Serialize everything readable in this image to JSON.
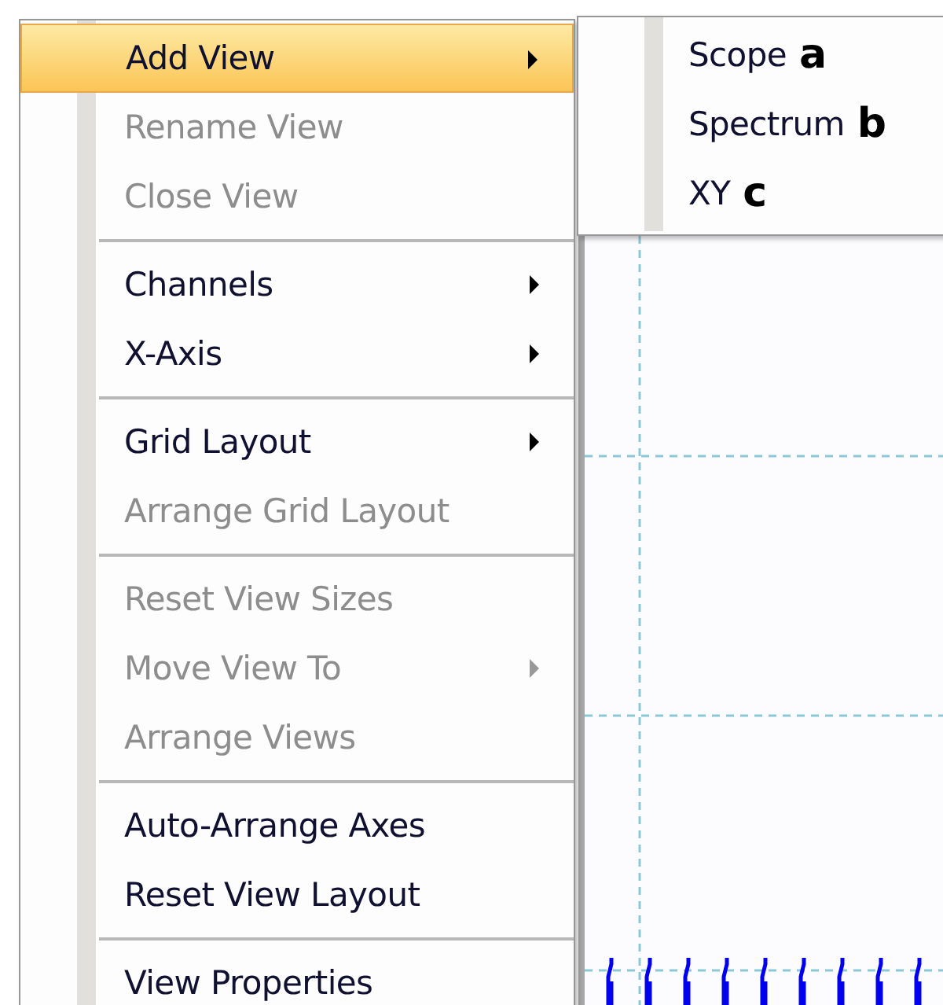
{
  "menu": {
    "items": [
      {
        "kind": "item",
        "label": "Add View",
        "selected": true,
        "disabled": false,
        "submenu": true
      },
      {
        "kind": "item",
        "label": "Rename View",
        "selected": false,
        "disabled": true,
        "submenu": false
      },
      {
        "kind": "item",
        "label": "Close View",
        "selected": false,
        "disabled": true,
        "submenu": false
      },
      {
        "kind": "separator"
      },
      {
        "kind": "item",
        "label": "Channels",
        "selected": false,
        "disabled": false,
        "submenu": true
      },
      {
        "kind": "item",
        "label": "X-Axis",
        "selected": false,
        "disabled": false,
        "submenu": true
      },
      {
        "kind": "separator"
      },
      {
        "kind": "item",
        "label": "Grid Layout",
        "selected": false,
        "disabled": false,
        "submenu": true
      },
      {
        "kind": "item",
        "label": "Arrange Grid Layout",
        "selected": false,
        "disabled": true,
        "submenu": false
      },
      {
        "kind": "separator"
      },
      {
        "kind": "item",
        "label": "Reset View Sizes",
        "selected": false,
        "disabled": true,
        "submenu": false
      },
      {
        "kind": "item",
        "label": "Move View To",
        "selected": false,
        "disabled": true,
        "submenu": true
      },
      {
        "kind": "item",
        "label": "Arrange Views",
        "selected": false,
        "disabled": true,
        "submenu": false
      },
      {
        "kind": "separator"
      },
      {
        "kind": "item",
        "label": "Auto-Arrange Axes",
        "selected": false,
        "disabled": false,
        "submenu": false
      },
      {
        "kind": "item",
        "label": "Reset View Layout",
        "selected": false,
        "disabled": false,
        "submenu": false
      },
      {
        "kind": "separator"
      },
      {
        "kind": "item",
        "label": "View Properties",
        "selected": false,
        "disabled": false,
        "submenu": false
      }
    ]
  },
  "submenu": {
    "items": [
      {
        "label": "Scope",
        "annotation": "a"
      },
      {
        "label": "Spectrum",
        "annotation": "b"
      },
      {
        "label": "XY",
        "annotation": "c"
      }
    ]
  }
}
